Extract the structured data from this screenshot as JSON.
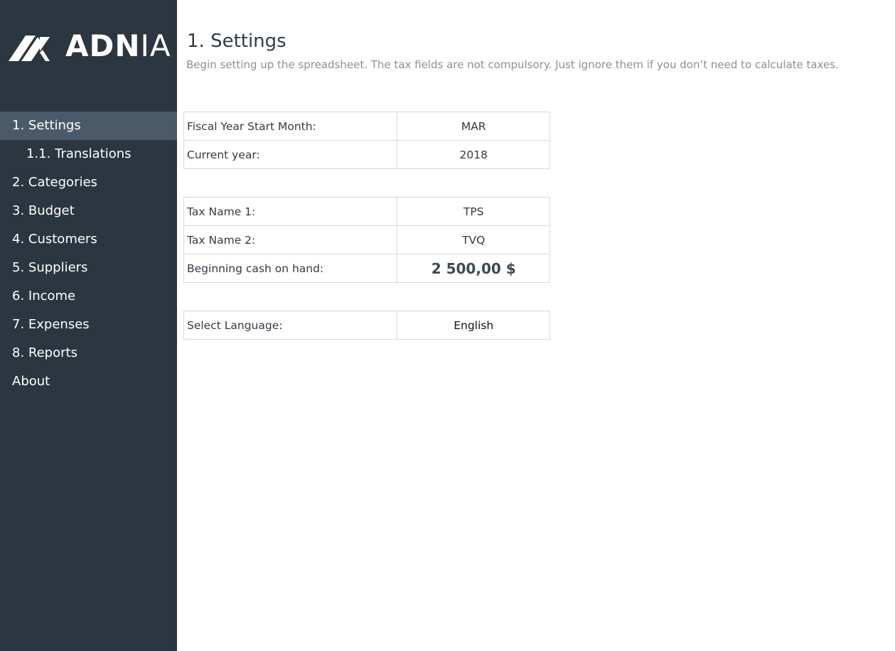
{
  "brand": {
    "logo_text_bold": "ADN",
    "logo_text_light": "IA",
    "colors": {
      "sidebar_bg": "#2c3640",
      "sidebar_active": "#4b5a68",
      "text_dark": "#333b44",
      "text_muted": "#8a8f95"
    }
  },
  "sidebar": {
    "items": [
      {
        "label": "1. Settings"
      },
      {
        "label": "1.1. Translations"
      },
      {
        "label": "2. Categories"
      },
      {
        "label": "3. Budget"
      },
      {
        "label": "4. Customers"
      },
      {
        "label": "5. Suppliers"
      },
      {
        "label": "6. Income"
      },
      {
        "label": "7. Expenses"
      },
      {
        "label": "8. Reports"
      },
      {
        "label": "About"
      }
    ]
  },
  "page": {
    "title": "1. Settings",
    "description": "Begin setting up the spreadsheet. The tax fields are not compulsory. Just ignore them if you don’t need to calculate taxes."
  },
  "settings": {
    "fiscal_year": {
      "label": "Fiscal Year Start Month:",
      "value": "MAR"
    },
    "current_year": {
      "label": "Current year:",
      "value": "2018"
    },
    "tax_name_1": {
      "label": "Tax Name 1:",
      "value": "TPS"
    },
    "tax_name_2": {
      "label": "Tax Name 2:",
      "value": "TVQ"
    },
    "beginning_cash": {
      "label": "Beginning cash on hand:",
      "value": "2 500,00 $"
    },
    "language": {
      "label": "Select Language:",
      "value": "English"
    }
  }
}
